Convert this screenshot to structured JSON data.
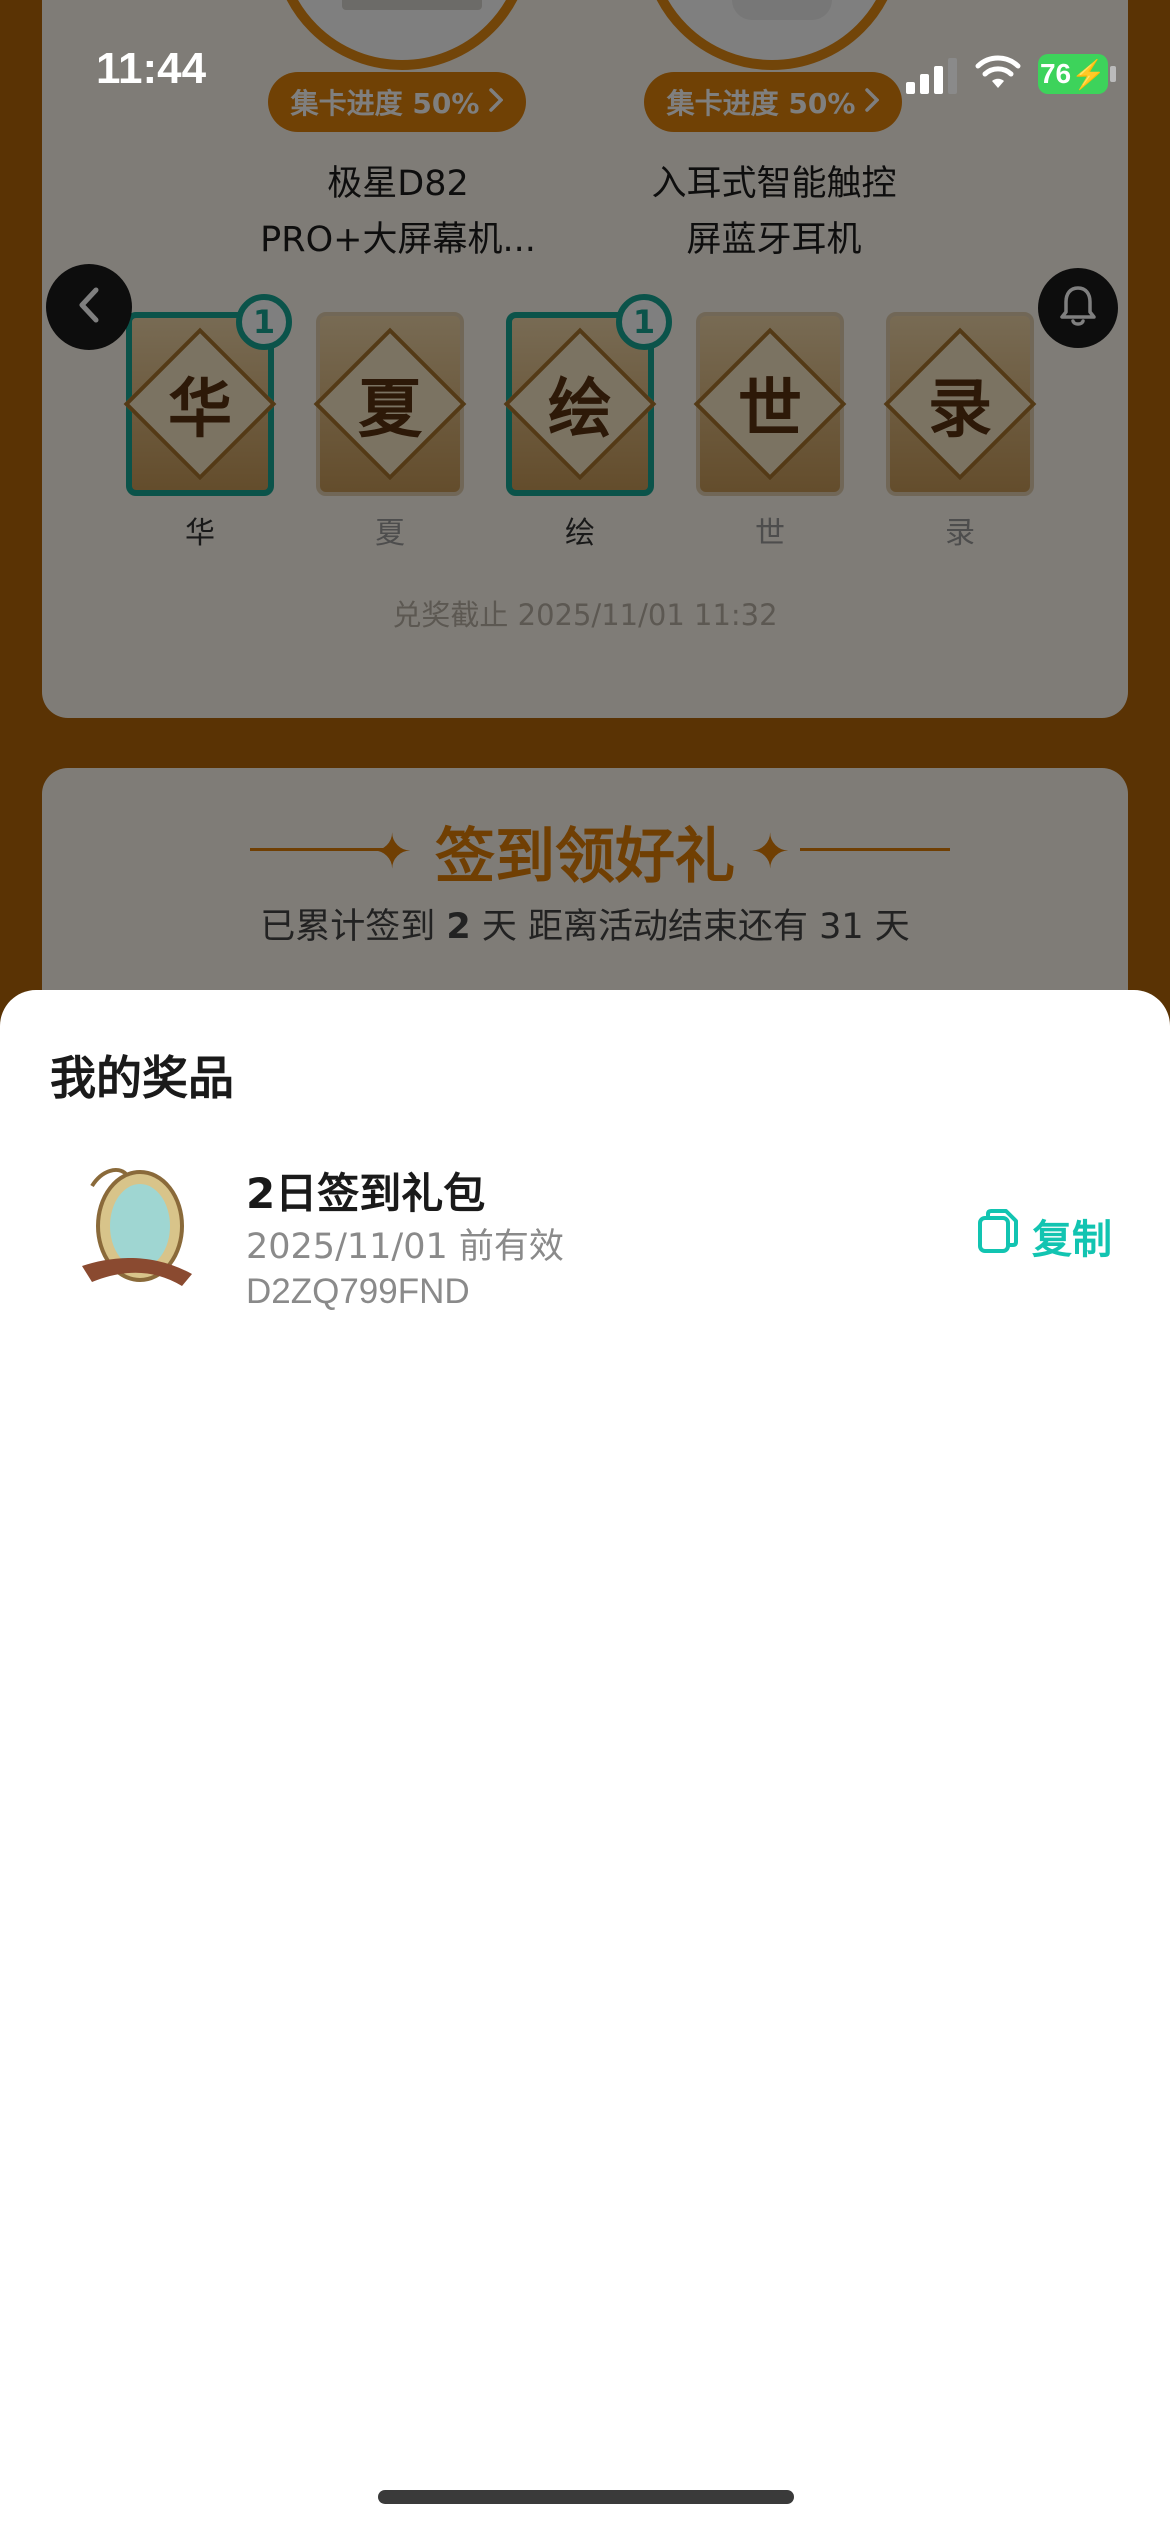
{
  "status_bar": {
    "time": "11:44",
    "battery": "76"
  },
  "background": {
    "products": [
      {
        "progress_label": "集卡进度 50%",
        "name_line1": "极星D82",
        "name_line2": "PRO+大屏幕机..."
      },
      {
        "progress_label": "集卡进度 50%",
        "name_line1": "入耳式智能触控",
        "name_line2": "屏蓝牙耳机"
      }
    ],
    "cards": [
      {
        "char": "华",
        "label": "华",
        "owned": true,
        "count": "1"
      },
      {
        "char": "夏",
        "label": "夏",
        "owned": false,
        "count": ""
      },
      {
        "char": "绘",
        "label": "绘",
        "owned": true,
        "count": "1"
      },
      {
        "char": "世",
        "label": "世",
        "owned": false,
        "count": ""
      },
      {
        "char": "录",
        "label": "录",
        "owned": false,
        "count": ""
      }
    ],
    "deadline": "兑奖截止 2025/11/01 11:32",
    "signin_title": "签到领好礼",
    "signin_sub_prefix": "已累计签到 ",
    "signin_days": "2",
    "signin_sub_suffix": " 天  距离活动结束还有 31 天"
  },
  "sheet": {
    "title": "我的奖品",
    "prizes": [
      {
        "name": "2日签到礼包",
        "expiry": "2025/11/01 前有效",
        "code": "D2ZQ799FND",
        "copy_label": "复制"
      }
    ]
  },
  "colors": {
    "accent_orange": "#e0820b",
    "teal": "#12c4b1",
    "battery_green": "#3dd35b"
  },
  "icons": [
    "back-arrow-icon",
    "bell-icon",
    "copy-icon",
    "chevron-right-icon",
    "signal-icon",
    "wifi-icon",
    "battery-icon"
  ]
}
